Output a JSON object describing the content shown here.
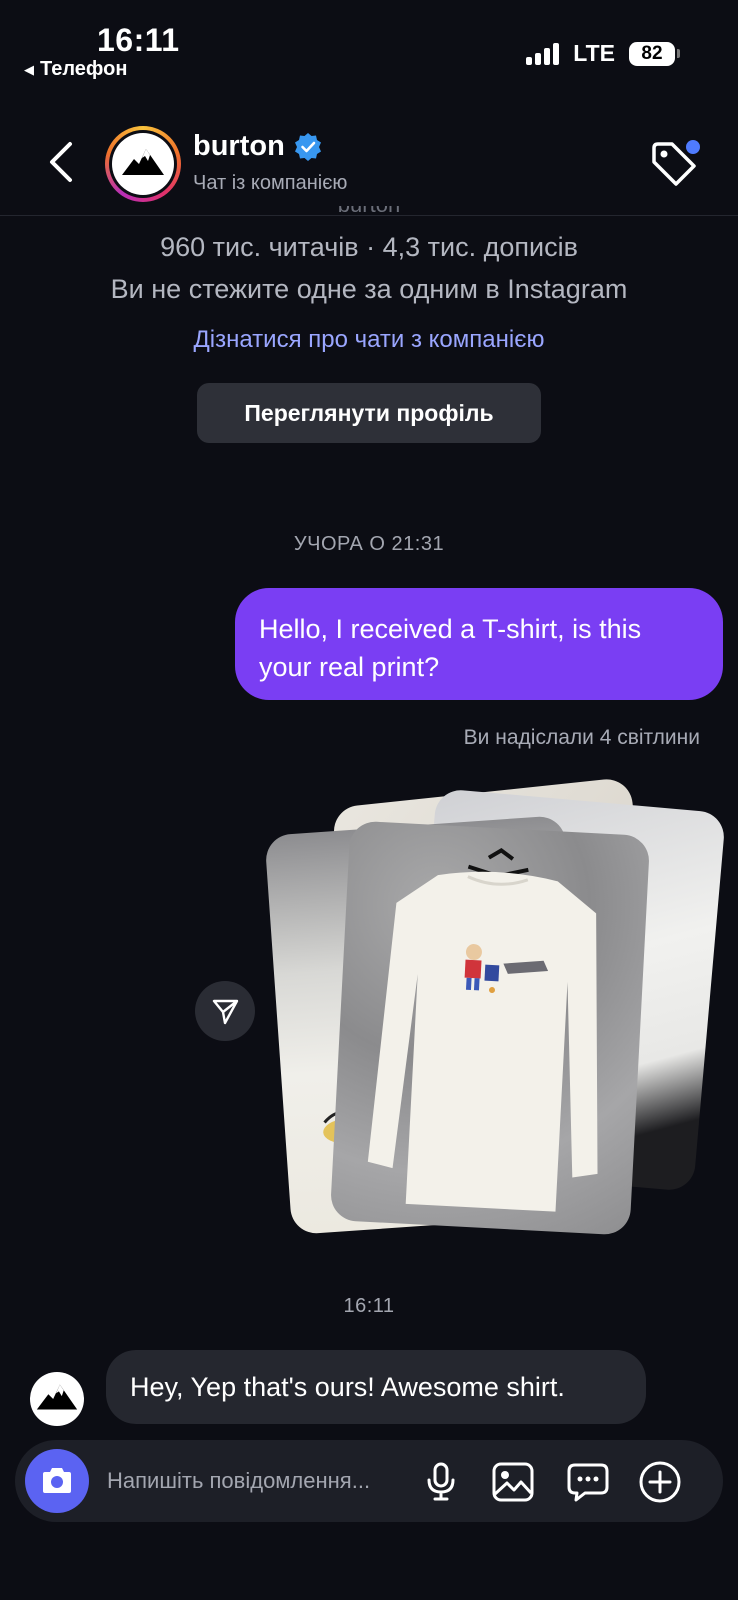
{
  "status_bar": {
    "time": "16:11",
    "back_app": "Телефон",
    "network": "LTE",
    "battery": "82"
  },
  "header": {
    "name": "burton",
    "subtitle": "Чат із компанією",
    "verified": true,
    "tag_has_badge": true
  },
  "profile": {
    "stats": "960 тис. читачів · 4,3 тис. дописів",
    "follow_status": "Ви не стежите одне за одним в Instagram",
    "link": "Дізнатися про чати з компанією",
    "view_profile_button": "Переглянути профіль"
  },
  "conversation": {
    "timestamp_1": "УЧОРА О 21:31",
    "outgoing_message": "Hello, I received a T-shirt, is this your real print?",
    "sent_photos_note": "Ви надіслали 4 світлини",
    "timestamp_2": "16:11",
    "incoming_message": "Hey, Yep that's ours! Awesome shirt."
  },
  "composer": {
    "placeholder": "Напишіть повідомлення..."
  },
  "colors": {
    "background": "#0c0d14",
    "outgoing_bubble": "#7a3ef3",
    "incoming_bubble": "#25272f",
    "link": "#9aa6ff",
    "camera_button": "#5b63f2",
    "verified_badge": "#3897f0"
  }
}
